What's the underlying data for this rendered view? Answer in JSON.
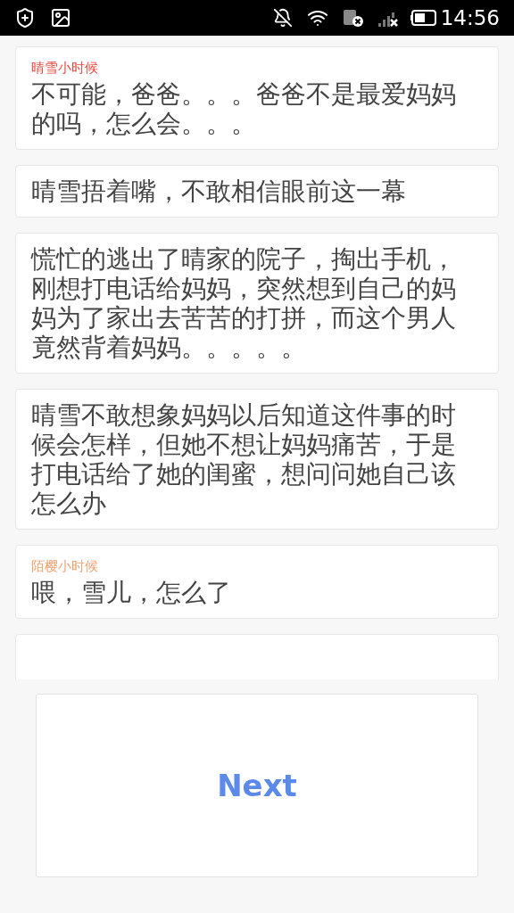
{
  "status_bar": {
    "time": "14:56"
  },
  "messages": [
    {
      "speaker": "晴雪小时候",
      "color": "#e8453c",
      "text": "不可能，爸爸。。。爸爸不是最爱妈妈的吗，怎么会。。。"
    },
    {
      "text": "晴雪捂着嘴，不敢相信眼前这一幕"
    },
    {
      "text": "慌忙的逃出了晴家的院子，掏出手机，刚想打电话给妈妈，突然想到自己的妈妈为了家出去苦苦的打拼，而这个男人竟然背着妈妈。。。。。"
    },
    {
      "text": "晴雪不敢想象妈妈以后知道这件事的时候会怎样，但她不想让妈妈痛苦，于是打电话给了她的闺蜜，想问问她自己该怎么办"
    },
    {
      "speaker": "陌樱小时候",
      "color": "#f0a070",
      "text": "喂，雪儿，怎么了"
    }
  ],
  "next_button": "Next"
}
